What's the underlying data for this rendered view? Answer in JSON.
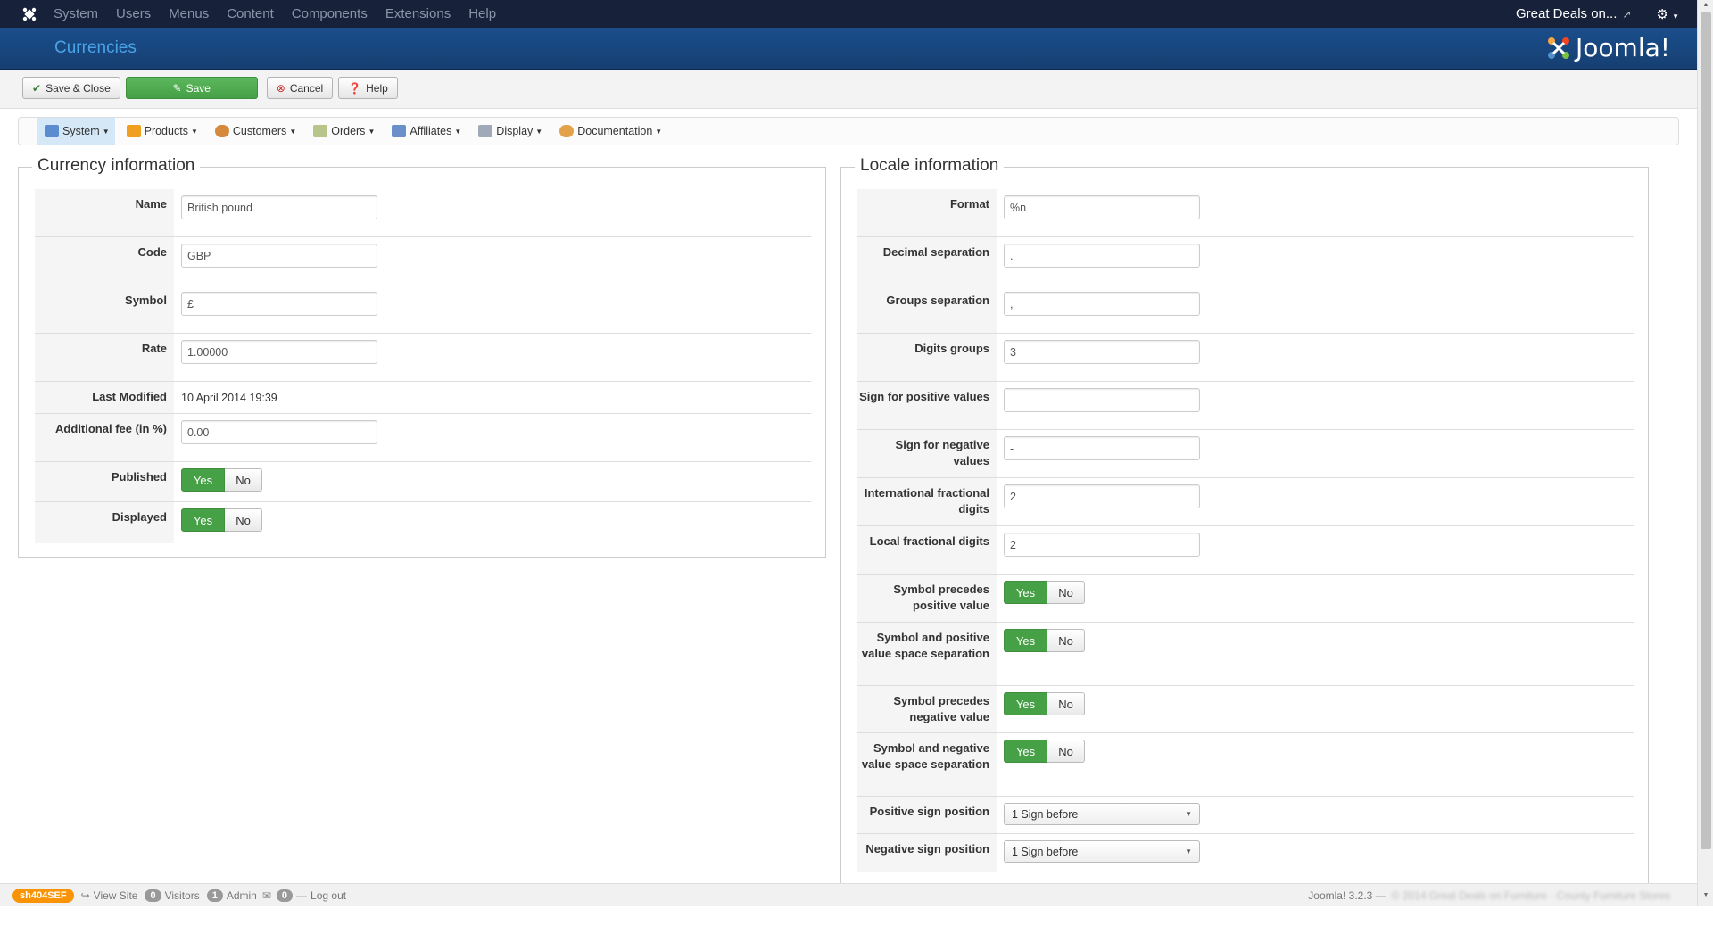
{
  "topnav": {
    "menu": [
      "System",
      "Users",
      "Menus",
      "Content",
      "Components",
      "Extensions",
      "Help"
    ],
    "site_name": "Great Deals on..."
  },
  "header": {
    "title": "Currencies",
    "brand": "Joomla!"
  },
  "toolbar": {
    "save_close": "Save & Close",
    "save": "Save",
    "cancel": "Cancel",
    "help": "Help"
  },
  "submenu": [
    "System",
    "Products",
    "Customers",
    "Orders",
    "Affiliates",
    "Display",
    "Documentation"
  ],
  "currency": {
    "legend": "Currency information",
    "name_label": "Name",
    "name": "British pound",
    "code_label": "Code",
    "code": "GBP",
    "symbol_label": "Symbol",
    "symbol": "£",
    "rate_label": "Rate",
    "rate": "1.00000",
    "modified_label": "Last Modified",
    "modified": "10 April 2014 19:39",
    "fee_label": "Additional fee (in %)",
    "fee": "0.00",
    "published_label": "Published",
    "displayed_label": "Displayed",
    "yes": "Yes",
    "no": "No"
  },
  "locale": {
    "legend": "Locale information",
    "format_label": "Format",
    "format": "%n",
    "decimal_label": "Decimal separation",
    "decimal": ".",
    "groups_label": "Groups separation",
    "groups": ",",
    "digits_label": "Digits groups",
    "digits": "3",
    "pos_sign_label": "Sign for positive values",
    "pos_sign": "",
    "neg_sign_label": "Sign for negative values",
    "neg_sign": "-",
    "intl_frac_label": "International fractional digits",
    "intl_frac": "2",
    "local_frac_label": "Local fractional digits",
    "local_frac": "2",
    "sym_pos_label": "Symbol precedes positive value",
    "sym_pos_space_label": "Symbol and positive value space separation",
    "sym_neg_label": "Symbol precedes negative value",
    "sym_neg_space_label": "Symbol and negative value space separation",
    "pos_pos_label": "Positive sign position",
    "pos_pos": "1 Sign before",
    "neg_pos_label": "Negative sign position",
    "neg_pos": "1 Sign before",
    "yes": "Yes",
    "no": "No"
  },
  "footer": {
    "sh404": "sh404SEF",
    "view_site": "View Site",
    "visitors_count": "0",
    "visitors": "Visitors",
    "admin_count": "1",
    "admin": "Admin",
    "msg_count": "0",
    "logout": "Log out",
    "version": "Joomla! 3.2.3 —",
    "copyright": "© 2014 Great Deals on Furniture · County Furniture Stores"
  }
}
